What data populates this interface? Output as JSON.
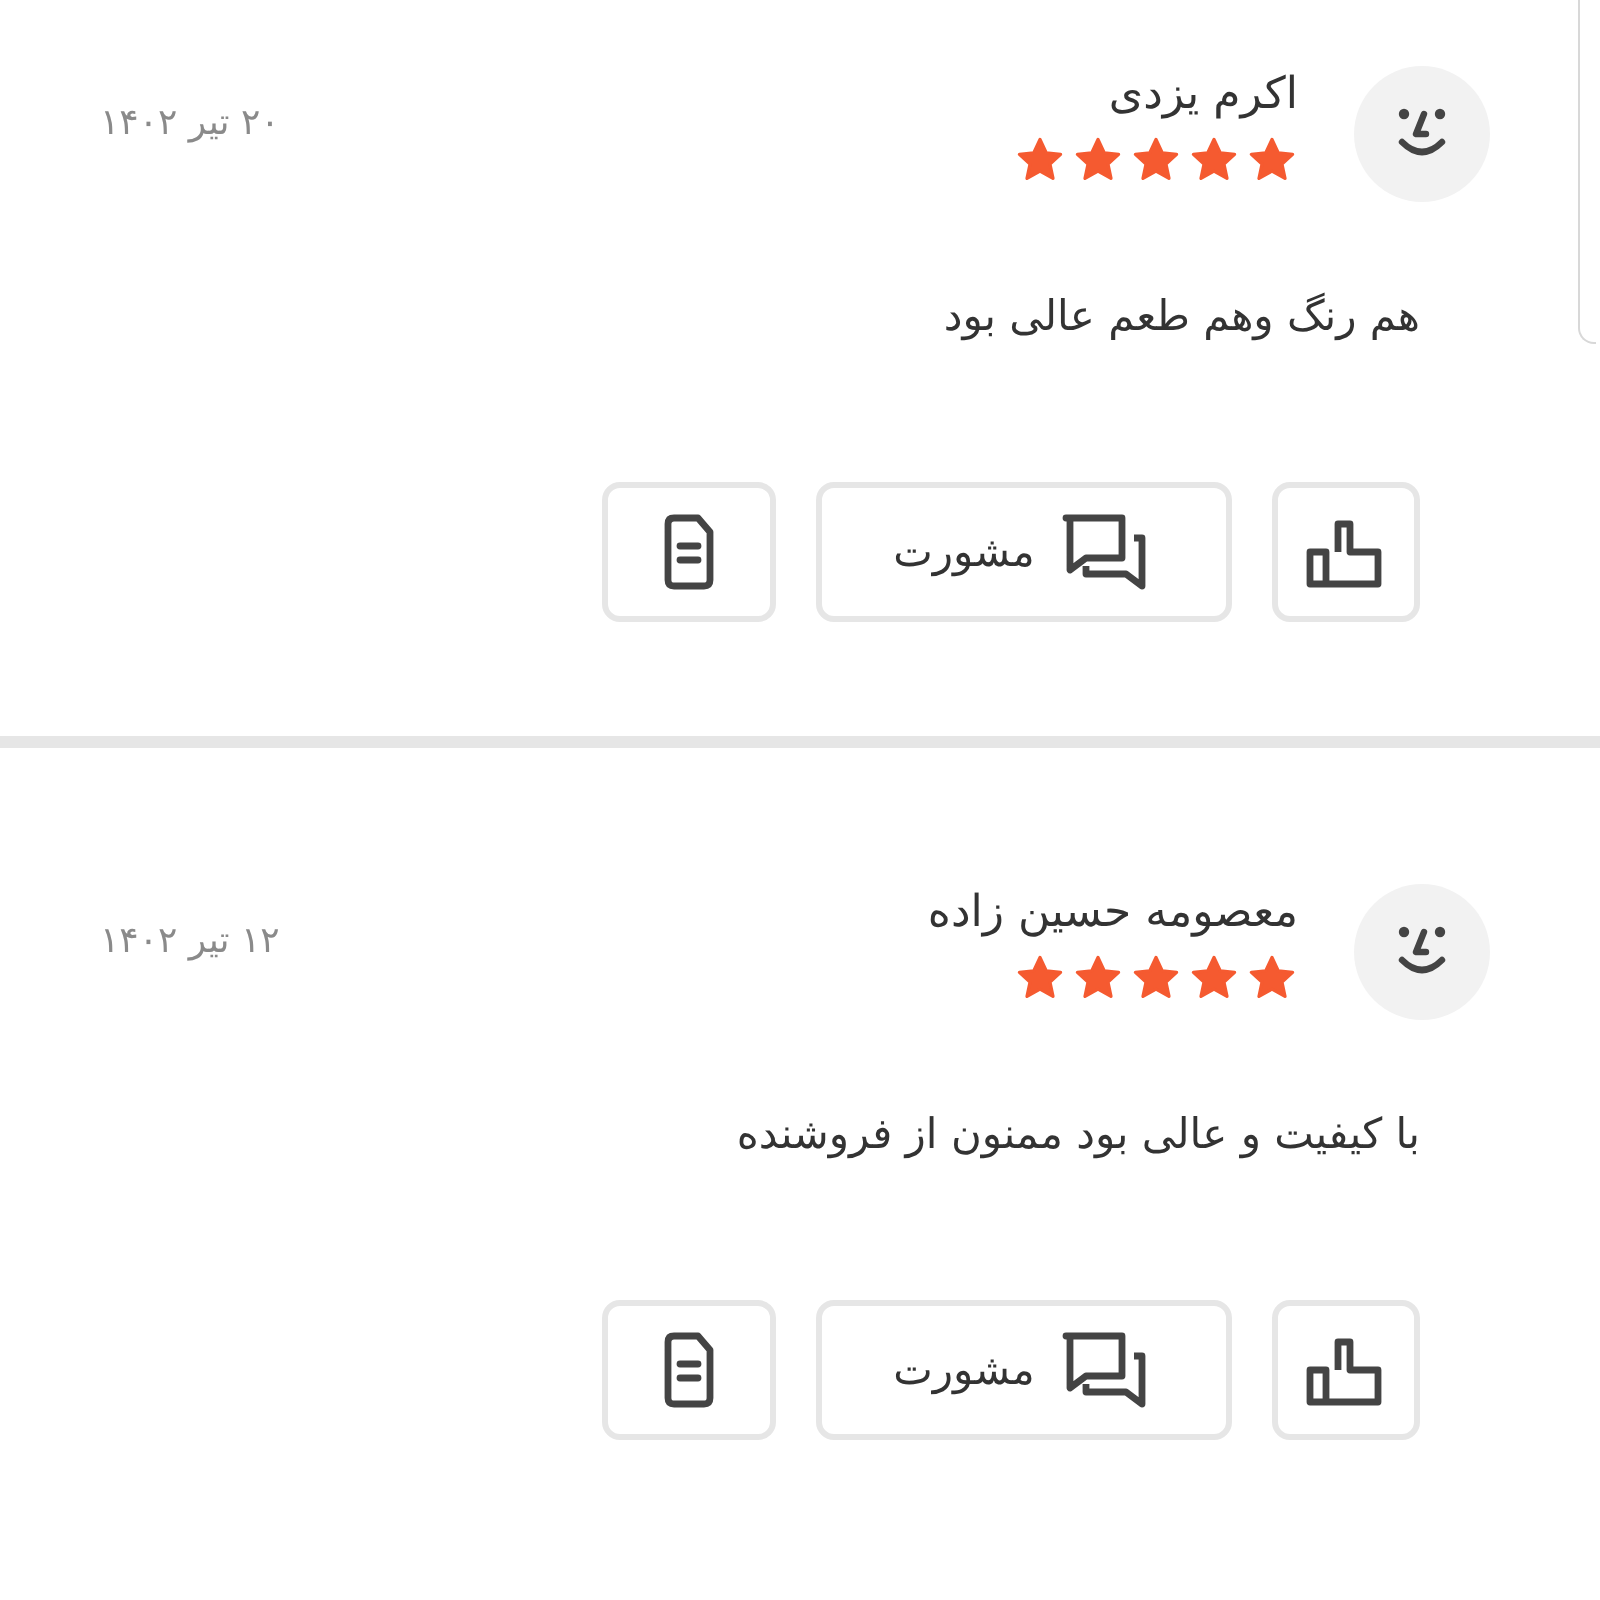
{
  "reviews": [
    {
      "name": "اکرم یزدی",
      "stars": 5,
      "date": "۲۰ تیر ۱۴۰۲",
      "comment": "هم رنگ وهم طعم عالی بود",
      "consult_label": "مشورت"
    },
    {
      "name": "معصومه حسین زاده",
      "stars": 5,
      "date": "۱۲ تیر ۱۴۰۲",
      "comment": "با کیفیت و عالی بود ممنون از فروشنده",
      "consult_label": "مشورت"
    }
  ]
}
